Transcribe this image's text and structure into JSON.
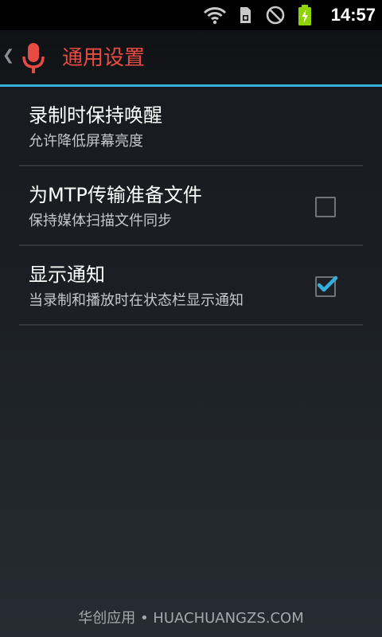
{
  "status_bar": {
    "time": "14:57",
    "icons": [
      "wifi-icon",
      "sd-card-icon",
      "do-not-disturb-icon",
      "battery-charging-icon"
    ],
    "battery_color": "#8fd400"
  },
  "action_bar": {
    "title": "通用设置",
    "title_color": "#e84b43",
    "icon": "microphone-icon",
    "divider_color": "#35b0dc"
  },
  "preferences": [
    {
      "title": "录制时保持唤醒",
      "summary": "允许降低屏幕亮度",
      "has_checkbox": false
    },
    {
      "title": "为MTP传输准备文件",
      "summary": "保持媒体扫描文件同步",
      "has_checkbox": true,
      "checked": false
    },
    {
      "title": "显示通知",
      "summary": "当录制和播放时在状态栏显示通知",
      "has_checkbox": true,
      "checked": true
    }
  ],
  "watermark": "华创应用 • HUACHUANGZS.COM"
}
